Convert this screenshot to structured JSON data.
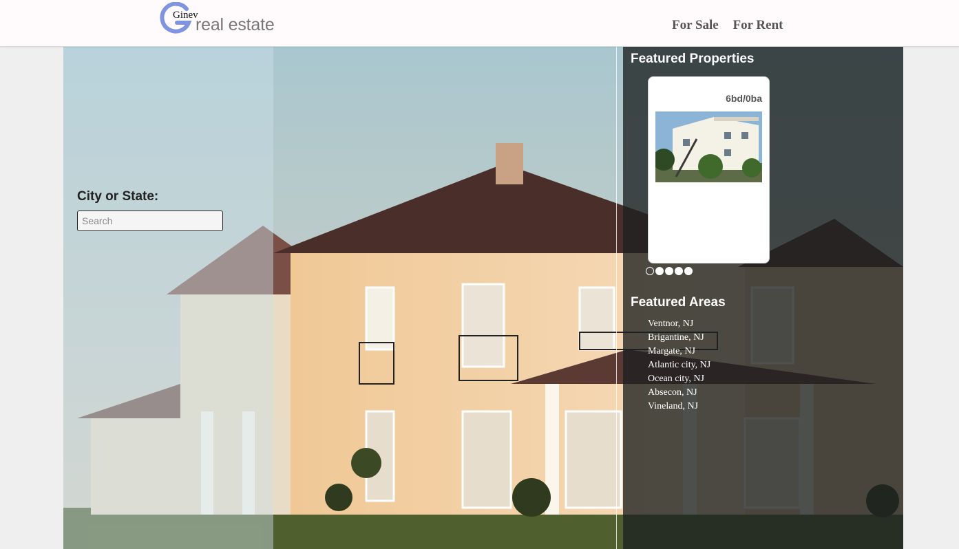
{
  "header": {
    "logo_small": "Ginev",
    "logo_main": "real estate",
    "nav": [
      {
        "label": "For Sale"
      },
      {
        "label": "For Rent"
      }
    ]
  },
  "search": {
    "label": "City or State:",
    "placeholder": "Search",
    "value": ""
  },
  "featured_properties": {
    "title": "Featured Properties",
    "card": {
      "rooms": "6bd/0ba"
    },
    "slider": {
      "total": 5,
      "active_index": 0
    }
  },
  "featured_areas": {
    "title": "Featured Areas",
    "items": [
      "Ventnor, NJ",
      "Brigantine, NJ",
      "Margate, NJ",
      "Atlantic city, NJ",
      "Ocean city, NJ",
      "Absecon, NJ",
      "Vineland, NJ"
    ]
  },
  "colors": {
    "logo_blue": "#7f94e0",
    "nav_text": "#555555",
    "panel_dark": "#1c2020"
  }
}
